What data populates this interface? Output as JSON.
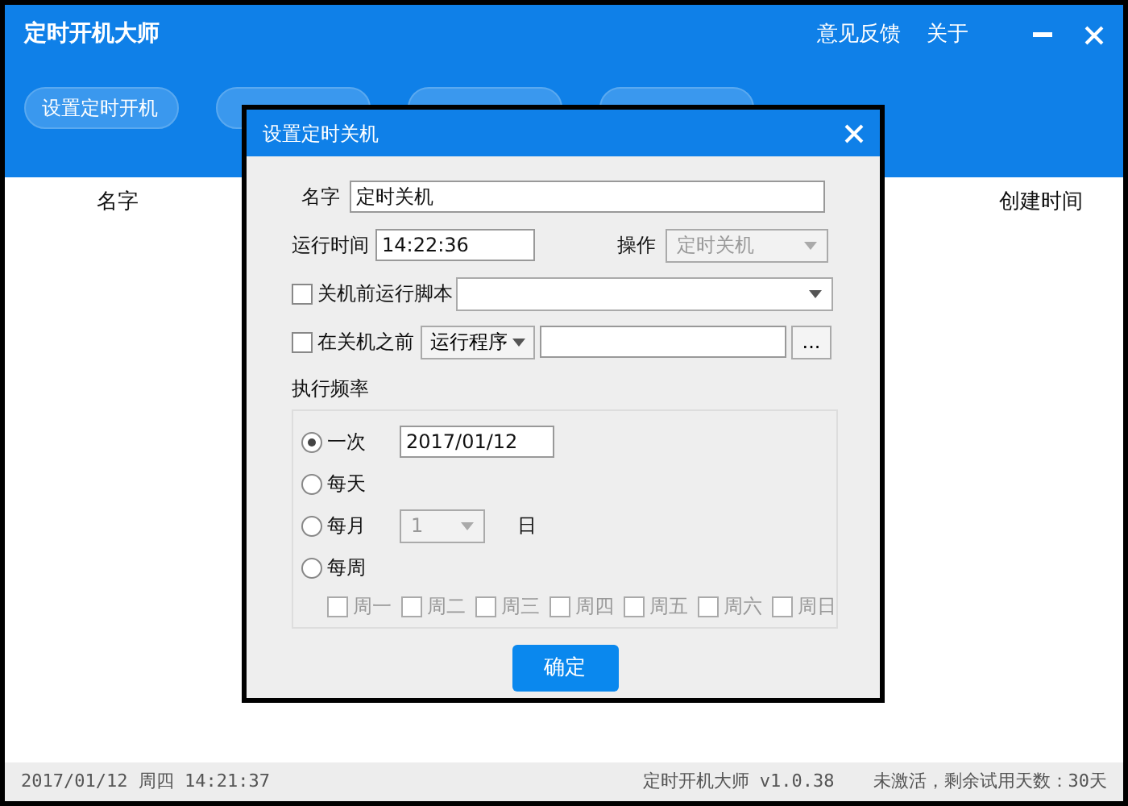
{
  "app": {
    "title": "定时开机大师",
    "header_links": [
      "意见反馈",
      "关于"
    ],
    "toolbar_buttons": [
      {
        "kind": "labeled",
        "label": "设置定时开机"
      },
      {
        "kind": "covered"
      },
      {
        "kind": "covered"
      },
      {
        "kind": "covered"
      }
    ],
    "table": {
      "columns": [
        "名字",
        "创建时间"
      ]
    }
  },
  "dialog": {
    "title": "设置定时关机",
    "name": {
      "label": "名字",
      "value": "定时关机"
    },
    "run_time": {
      "label": "运行时间",
      "value": "14:22:36"
    },
    "operation": {
      "label": "操作",
      "value": "定时关机",
      "disabled": true
    },
    "script_option": {
      "label": "关机前运行脚本",
      "checked": false
    },
    "before_option": {
      "label": "在关机之前",
      "checked": false,
      "action": "运行程序",
      "browse": "..."
    },
    "frequency": {
      "label": "执行频率",
      "options": [
        {
          "kind": "date",
          "label": "一次",
          "selected": true,
          "value": "2017/01/12"
        },
        {
          "kind": "plain",
          "label": "每天",
          "selected": false
        },
        {
          "kind": "day",
          "label": "每月",
          "selected": false,
          "value": "1",
          "suffix": "日",
          "disabled": true
        },
        {
          "kind": "weekdays",
          "label": "每周",
          "selected": false,
          "disabled": true,
          "days": [
            {
              "label": "周一",
              "checked": false
            },
            {
              "label": "周二",
              "checked": false
            },
            {
              "label": "周三",
              "checked": false
            },
            {
              "label": "周四",
              "checked": false
            },
            {
              "label": "周五",
              "checked": false
            },
            {
              "label": "周六",
              "checked": false
            },
            {
              "label": "周日",
              "checked": false
            }
          ]
        }
      ]
    },
    "ok_button": "确定"
  },
  "status_bar": {
    "datetime": "2017/01/12 周四 14:21:37",
    "version": "定时开机大师 v1.0.38",
    "trial": "未激活，剩余试用天数：30天"
  }
}
